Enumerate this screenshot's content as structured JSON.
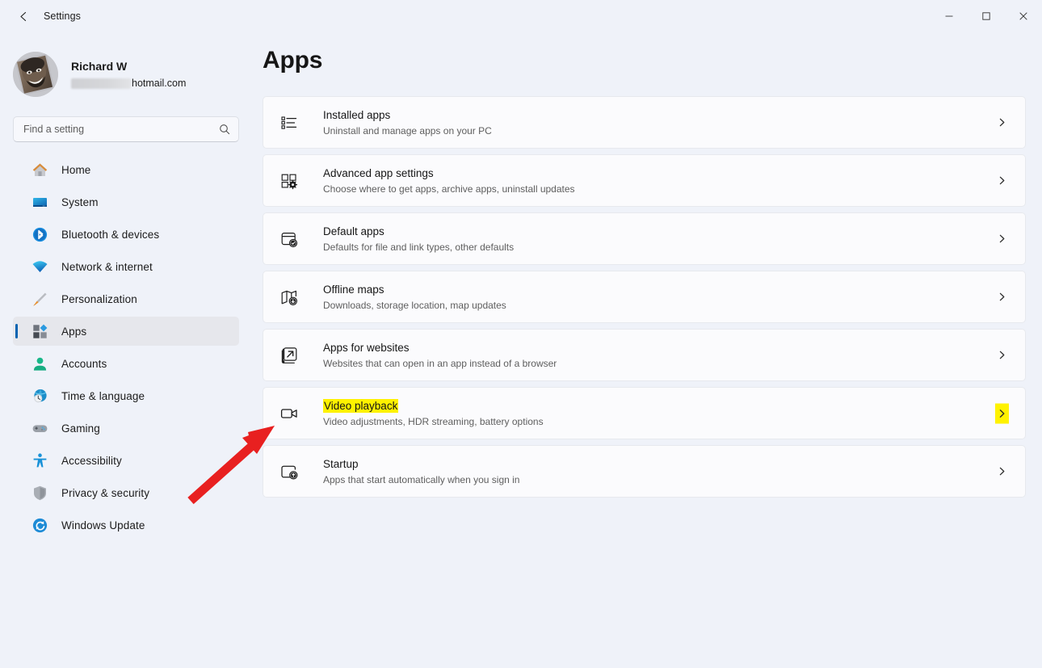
{
  "window": {
    "title": "Settings",
    "back_icon": "back-arrow-icon",
    "minimize_label": "—",
    "maximize_label": "□",
    "close_label": "✕"
  },
  "sidebar": {
    "profile": {
      "name": "Richard W",
      "email_suffix": "hotmail.com",
      "email_redacted": true,
      "avatar_icon": "user-avatar"
    },
    "search": {
      "placeholder": "Find a setting",
      "value": "",
      "icon": "search-icon"
    },
    "items": [
      {
        "label": "Home",
        "icon": "home-icon",
        "selected": false
      },
      {
        "label": "System",
        "icon": "system-icon",
        "selected": false
      },
      {
        "label": "Bluetooth & devices",
        "icon": "bluetooth-icon",
        "selected": false
      },
      {
        "label": "Network & internet",
        "icon": "wifi-icon",
        "selected": false
      },
      {
        "label": "Personalization",
        "icon": "paintbrush-icon",
        "selected": false
      },
      {
        "label": "Apps",
        "icon": "apps-icon",
        "selected": true
      },
      {
        "label": "Accounts",
        "icon": "account-icon",
        "selected": false
      },
      {
        "label": "Time & language",
        "icon": "clock-globe-icon",
        "selected": false
      },
      {
        "label": "Gaming",
        "icon": "gamepad-icon",
        "selected": false
      },
      {
        "label": "Accessibility",
        "icon": "accessibility-icon",
        "selected": false
      },
      {
        "label": "Privacy & security",
        "icon": "shield-icon",
        "selected": false
      },
      {
        "label": "Windows Update",
        "icon": "update-icon",
        "selected": false
      }
    ]
  },
  "main": {
    "page_title": "Apps",
    "cards": [
      {
        "title": "Installed apps",
        "subtitle": "Uninstall and manage apps on your PC",
        "icon": "list-bullets-icon",
        "highlighted": false
      },
      {
        "title": "Advanced app settings",
        "subtitle": "Choose where to get apps, archive apps, uninstall updates",
        "icon": "advanced-settings-icon",
        "highlighted": false
      },
      {
        "title": "Default apps",
        "subtitle": "Defaults for file and link types, other defaults",
        "icon": "default-apps-icon",
        "highlighted": false
      },
      {
        "title": "Offline maps",
        "subtitle": "Downloads, storage location, map updates",
        "icon": "map-download-icon",
        "highlighted": false
      },
      {
        "title": "Apps for websites",
        "subtitle": "Websites that can open in an app instead of a browser",
        "icon": "external-link-icon",
        "highlighted": false
      },
      {
        "title": "Video playback",
        "subtitle": "Video adjustments, HDR streaming, battery options",
        "icon": "video-camera-icon",
        "highlighted": true
      },
      {
        "title": "Startup",
        "subtitle": "Apps that start automatically when you sign in",
        "icon": "startup-icon",
        "highlighted": false
      }
    ],
    "chevron_icon": "chevron-right-icon"
  },
  "annotations": {
    "arrow": {
      "color": "#e82020",
      "points_to": "Video playback"
    },
    "highlight_color": "#fff200"
  },
  "colors": {
    "window_background": "#eff2f9",
    "card_background": "#fbfbfd",
    "card_border": "#e7e9ee",
    "accent": "#0063b1",
    "selected_nav_background": "#e6e7ec",
    "highlight_yellow": "#fff200",
    "arrow_red": "#e82020"
  }
}
